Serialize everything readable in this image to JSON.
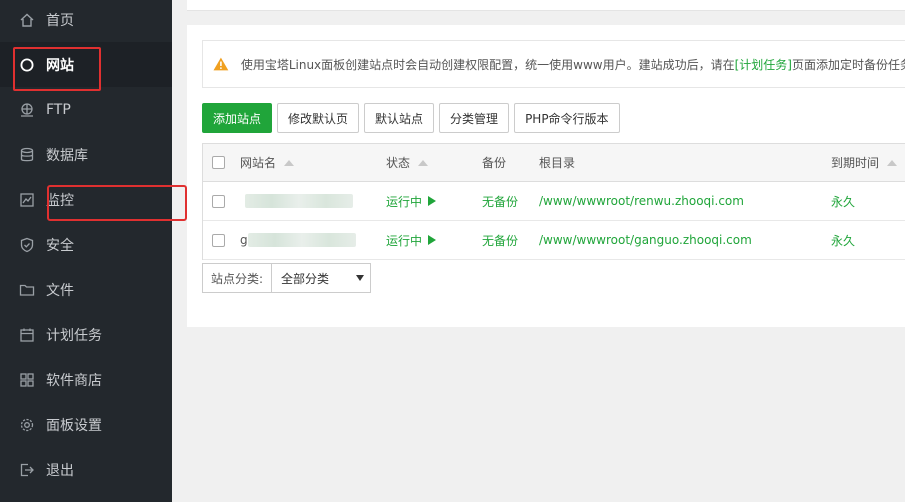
{
  "sidebar": {
    "items": [
      {
        "label": "首页",
        "icon": "home-icon"
      },
      {
        "label": "网站",
        "icon": "globe-icon"
      },
      {
        "label": "FTP",
        "icon": "ftp-icon"
      },
      {
        "label": "数据库",
        "icon": "database-icon"
      },
      {
        "label": "监控",
        "icon": "monitor-icon"
      },
      {
        "label": "安全",
        "icon": "shield-icon"
      },
      {
        "label": "文件",
        "icon": "folder-icon"
      },
      {
        "label": "计划任务",
        "icon": "calendar-icon"
      },
      {
        "label": "软件商店",
        "icon": "grid-icon"
      },
      {
        "label": "面板设置",
        "icon": "gear-icon"
      },
      {
        "label": "退出",
        "icon": "logout-icon"
      }
    ],
    "active_index": 1
  },
  "notice": {
    "text_before": "使用宝塔Linux面板创建站点时会自动创建权限配置，统一使用www用户。建站成功后，请在",
    "link": "[计划任务]",
    "text_after": "页面添加定时备份任务"
  },
  "toolbar": {
    "add_site": "添加站点",
    "edit_default_page": "修改默认页",
    "default_site": "默认站点",
    "category_manage": "分类管理",
    "php_cli_version": "PHP命令行版本"
  },
  "table": {
    "headers": {
      "name": "网站名",
      "status": "状态",
      "backup": "备份",
      "root": "根目录",
      "expire": "到期时间"
    },
    "rows": [
      {
        "name_prefix": "",
        "status": "运行中",
        "backup": "无备份",
        "root": "/www/wwwroot/renwu.zhooqi.com",
        "expire": "永久"
      },
      {
        "name_prefix": "g",
        "status": "运行中",
        "backup": "无备份",
        "root": "/www/wwwroot/ganguo.zhooqi.com",
        "expire": "永久"
      }
    ]
  },
  "filter": {
    "label": "站点分类:",
    "selected": "全部分类"
  },
  "colors": {
    "accent": "#20a53a",
    "sidebar_bg": "#23282d",
    "highlight": "#e03030"
  }
}
